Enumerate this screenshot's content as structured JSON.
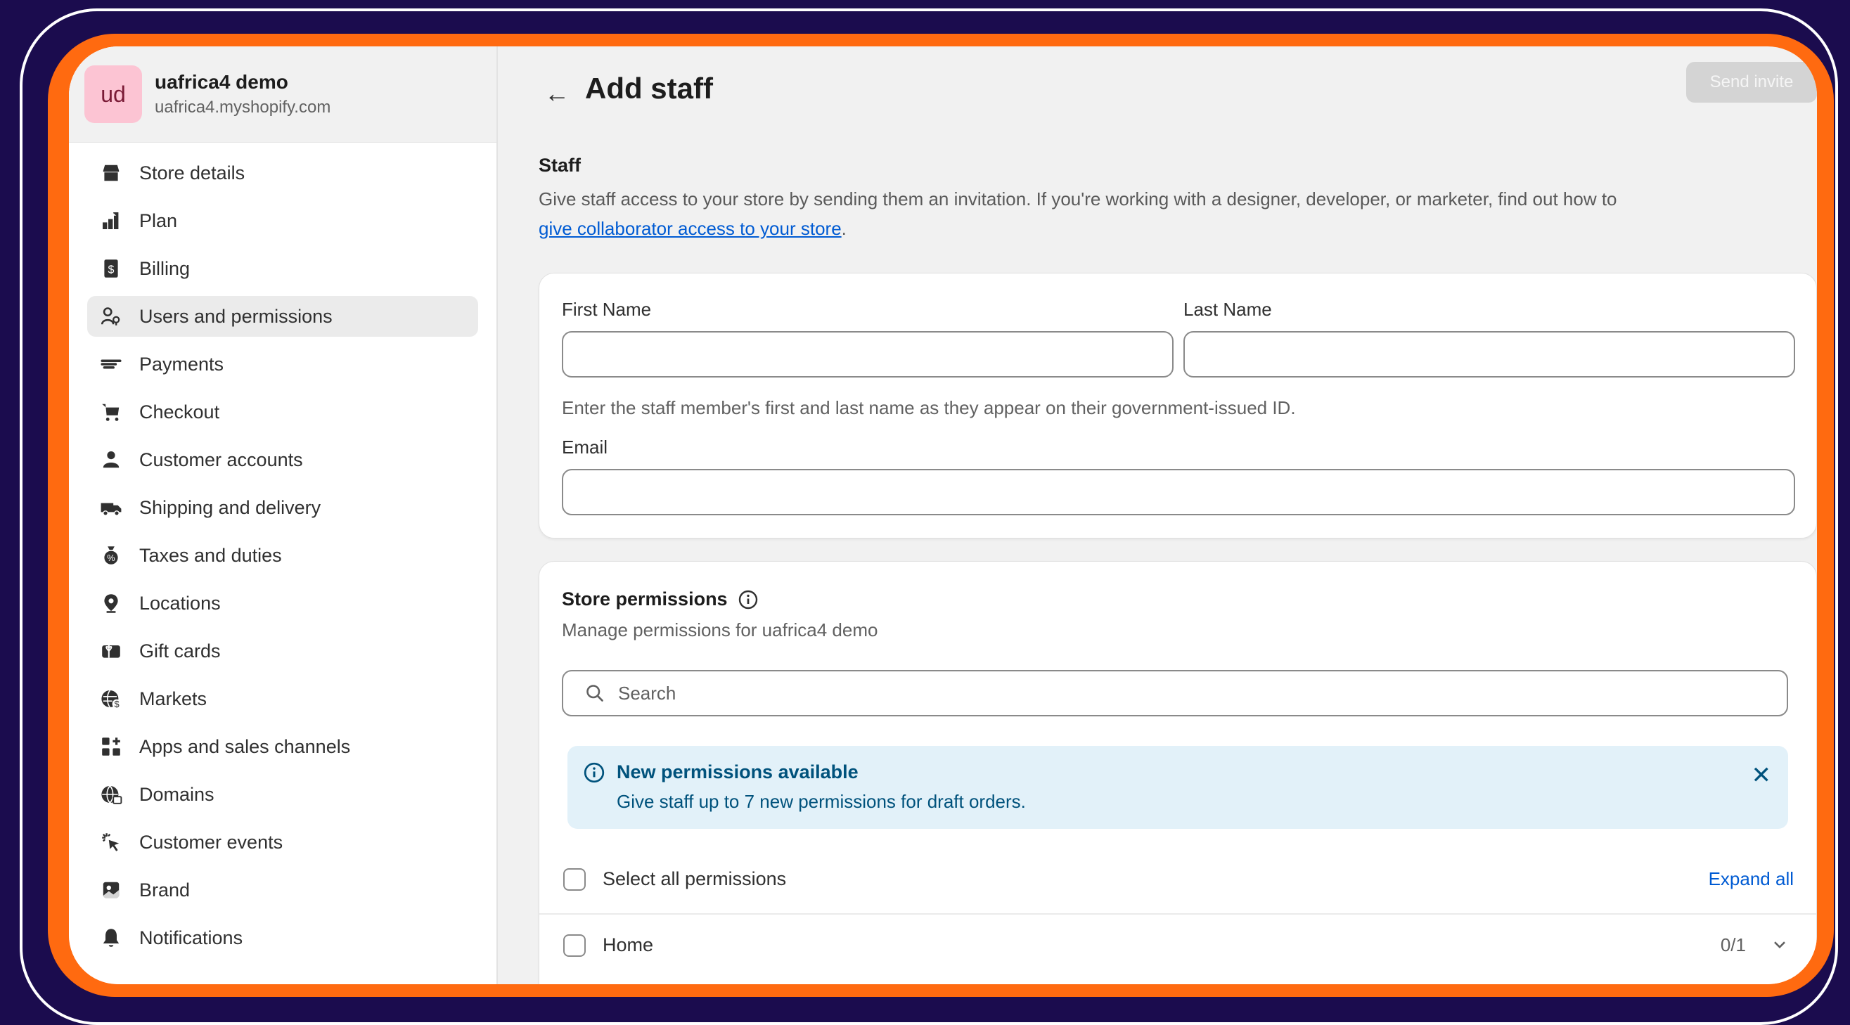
{
  "store": {
    "avatar_initials": "ud",
    "name": "uafrica4 demo",
    "domain": "uafrica4.myshopify.com"
  },
  "sidebar": {
    "items": [
      {
        "label": "Store details",
        "icon": "store-icon"
      },
      {
        "label": "Plan",
        "icon": "plan-icon"
      },
      {
        "label": "Billing",
        "icon": "billing-icon"
      },
      {
        "label": "Users and permissions",
        "icon": "users-icon",
        "active": true
      },
      {
        "label": "Payments",
        "icon": "payments-icon"
      },
      {
        "label": "Checkout",
        "icon": "cart-icon"
      },
      {
        "label": "Customer accounts",
        "icon": "person-icon"
      },
      {
        "label": "Shipping and delivery",
        "icon": "truck-icon"
      },
      {
        "label": "Taxes and duties",
        "icon": "tax-icon"
      },
      {
        "label": "Locations",
        "icon": "location-pin-icon"
      },
      {
        "label": "Gift cards",
        "icon": "gift-card-icon"
      },
      {
        "label": "Markets",
        "icon": "globe-currency-icon"
      },
      {
        "label": "Apps and sales channels",
        "icon": "apps-icon"
      },
      {
        "label": "Domains",
        "icon": "globe-icon"
      },
      {
        "label": "Customer events",
        "icon": "cursor-click-icon"
      },
      {
        "label": "Brand",
        "icon": "brand-icon"
      },
      {
        "label": "Notifications",
        "icon": "bell-icon"
      }
    ]
  },
  "header": {
    "title": "Add staff",
    "send_invite_label": "Send invite"
  },
  "staff_section": {
    "title": "Staff",
    "description": "Give staff access to your store by sending them an invitation. If you're working with a designer, developer, or marketer, find out how to",
    "link_text": "give collaborator access to your store",
    "period": "."
  },
  "form": {
    "first_name_label": "First Name",
    "first_name_value": "",
    "last_name_label": "Last Name",
    "last_name_value": "",
    "name_help": "Enter the staff member's first and last name as they appear on their government-issued ID.",
    "email_label": "Email",
    "email_value": ""
  },
  "permissions": {
    "title": "Store permissions",
    "description": "Manage permissions for uafrica4 demo",
    "search_placeholder": "Search",
    "banner_title": "New permissions available",
    "banner_text": "Give staff up to 7 new permissions for draft orders.",
    "select_all_label": "Select all permissions",
    "expand_all_label": "Expand all",
    "rows": [
      {
        "label": "Home",
        "count": "0/1"
      }
    ]
  },
  "colors": {
    "background": "#1b0c4e",
    "frame": "#ff6a10",
    "link": "#005bd3",
    "banner_bg": "#e2f1f9",
    "banner_text": "#00527c"
  }
}
